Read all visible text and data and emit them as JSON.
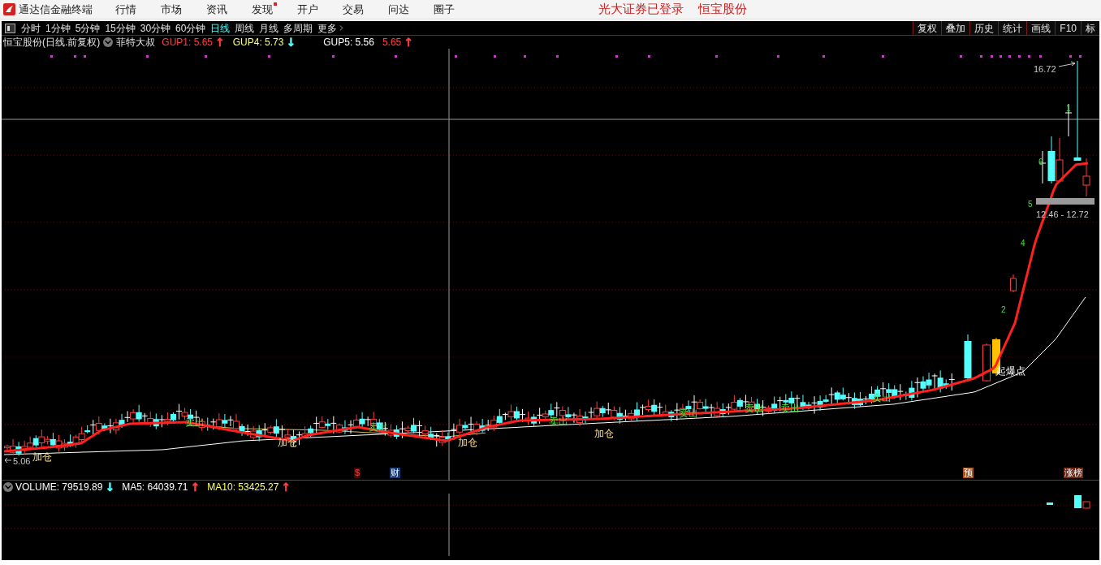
{
  "menu_bar": {
    "app_name": "通达信金融终端",
    "items": [
      {
        "label": "行情",
        "badge": false
      },
      {
        "label": "市场",
        "badge": false
      },
      {
        "label": "资讯",
        "badge": false
      },
      {
        "label": "发现",
        "badge": true
      },
      {
        "label": "开户",
        "badge": false
      },
      {
        "label": "交易",
        "badge": false
      },
      {
        "label": "问达",
        "badge": false
      },
      {
        "label": "圈子",
        "badge": false
      }
    ],
    "login_status": "光大证券已登录",
    "stock_name": "恒宝股份"
  },
  "period_tabs": [
    {
      "label": "分时",
      "selected": false
    },
    {
      "label": "1分钟",
      "selected": false
    },
    {
      "label": "5分钟",
      "selected": false
    },
    {
      "label": "15分钟",
      "selected": false
    },
    {
      "label": "30分钟",
      "selected": false
    },
    {
      "label": "60分钟",
      "selected": false
    },
    {
      "label": "日线",
      "selected": true
    },
    {
      "label": "周线",
      "selected": false
    },
    {
      "label": "月线",
      "selected": false
    },
    {
      "label": "多周期",
      "selected": false
    },
    {
      "label": "更多",
      "selected": false
    }
  ],
  "tools": [
    "复权",
    "叠加",
    "历史",
    "统计",
    "画线",
    "F10",
    "标"
  ],
  "chart_header": {
    "title": "恒宝股份(日线.前复权)",
    "indicator": "菲特大叔",
    "readings": [
      {
        "text": "GUP1: 5.65",
        "color": "#ff4040",
        "arrow": {
          "text": "↑",
          "color": "#ff4040"
        }
      },
      {
        "text": "GUP4: 5.73",
        "color": "#ffff66",
        "arrow": {
          "text": "↓",
          "color": "#54ffff"
        }
      },
      {
        "text": "GUP5: 5.56",
        "color": "#ffffff"
      },
      {
        "text": "5.65",
        "color": "#ff4040",
        "arrow": {
          "text": "↑",
          "color": "#ff4040"
        }
      }
    ]
  },
  "chart_labels": [
    {
      "text": "16.72",
      "kind": "price"
    },
    {
      "text": "5.06",
      "kind": "price"
    },
    {
      "text": "12.46 - 12.72",
      "kind": "price"
    },
    {
      "text": "1",
      "kind": "count"
    },
    {
      "text": "6",
      "kind": "count"
    },
    {
      "text": "5",
      "kind": "count"
    },
    {
      "text": "4",
      "kind": "count"
    },
    {
      "text": "2",
      "kind": "count"
    },
    {
      "text": "加仓",
      "kind": "buy"
    },
    {
      "text": "加仓",
      "kind": "buy"
    },
    {
      "text": "加仓",
      "kind": "buy"
    },
    {
      "text": "加仓",
      "kind": "buy"
    },
    {
      "text": "卖出",
      "kind": "sell"
    },
    {
      "text": "卖出",
      "kind": "sell"
    },
    {
      "text": "卖出",
      "kind": "sell"
    },
    {
      "text": "卖出",
      "kind": "sell"
    },
    {
      "text": "卖出",
      "kind": "sell"
    },
    {
      "text": "卖出",
      "kind": "sell"
    },
    {
      "text": "卖出",
      "kind": "sell"
    },
    {
      "text": "起爆点",
      "kind": "breakout"
    }
  ],
  "event_badges": [
    {
      "text": "$",
      "color": "#3c0a0a"
    },
    {
      "text": "财",
      "color": "#1c3c78"
    },
    {
      "text": "预",
      "color": "#a0521e"
    },
    {
      "text": "涨榜",
      "color": "#6e2814"
    }
  ],
  "volume_header": [
    {
      "text": "VOLUME: 79519.89",
      "color": "#ffffff",
      "arrow": {
        "text": "↓",
        "color": "#54ffff"
      }
    },
    {
      "text": "MA5: 64039.71",
      "color": "#ffffff",
      "arrow": {
        "text": "↑",
        "color": "#ff4040"
      }
    },
    {
      "text": "MA10: 53425.27",
      "color": "#ffff66",
      "arrow": {
        "text": "↑",
        "color": "#ff4040"
      }
    }
  ]
}
